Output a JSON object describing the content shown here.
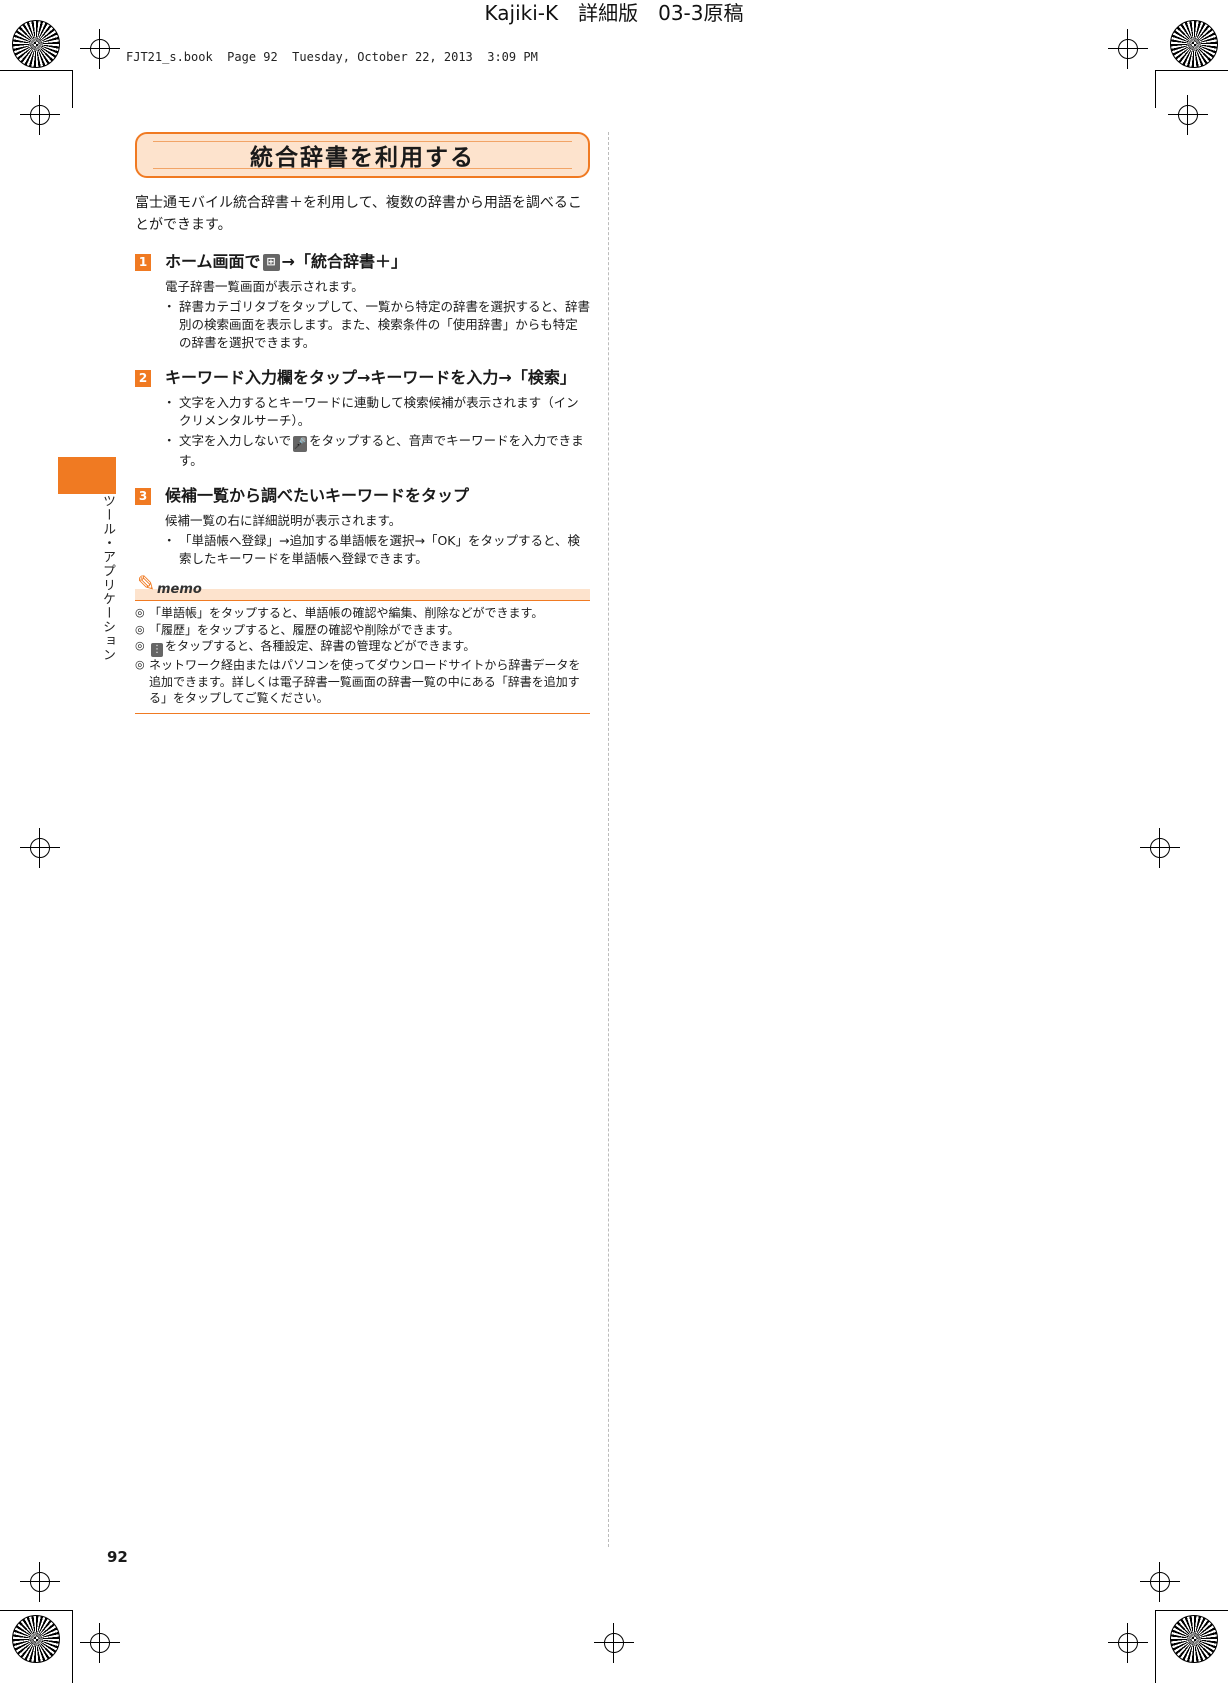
{
  "header": {
    "title": "Kajiki-K　詳細版　03-3原稿",
    "book_info": "FJT21_s.book  Page 92  Tuesday, October 22, 2013  3:09 PM"
  },
  "section": {
    "title": "統合辞書を利用する",
    "intro": "富士通モバイル統合辞書＋を利用して、複数の辞書から用語を調べることができます。"
  },
  "steps": [
    {
      "num": "1",
      "title_before": "ホーム画面で",
      "icon": "grid-icon",
      "title_after": "→「統合辞書＋」",
      "desc": "電子辞書一覧画面が表示されます。",
      "bullets": [
        "辞書カテゴリタブをタップして、一覧から特定の辞書を選択すると、辞書別の検索画面を表示します。また、検索条件の「使用辞書」からも特定の辞書を選択できます。"
      ]
    },
    {
      "num": "2",
      "title": "キーワード入力欄をタップ→キーワードを入力→「検索」",
      "bullets": [
        "文字を入力するとキーワードに連動して検索候補が表示されます（インクリメンタルサーチ）。",
        "文字を入力しないで",
        "をタップすると、音声でキーワードを入力できます。"
      ],
      "mic_icon": "microphone-icon"
    },
    {
      "num": "3",
      "title": "候補一覧から調べたいキーワードをタップ",
      "desc": "候補一覧の右に詳細説明が表示されます。",
      "bullets": [
        "「単語帳へ登録」→追加する単語帳を選択→「OK」をタップすると、検索したキーワードを単語帳へ登録できます。"
      ]
    }
  ],
  "memo": {
    "label": "memo",
    "items": [
      "「単語帳」をタップすると、単語帳の確認や編集、削除などができます。",
      "「履歴」をタップすると、履歴の確認や削除ができます。",
      "をタップすると、各種設定、辞書の管理などができます。",
      "ネットワーク経由またはパソコンを使ってダウンロードサイトから辞書データを追加できます。詳しくは電子辞書一覧画面の辞書一覧の中にある「辞書を追加する」をタップしてご覧ください。"
    ],
    "menu_icon": "menu-icon"
  },
  "side_label": "ツール・アプリケーション",
  "page_number": "92",
  "colors": {
    "accent": "#f07a22",
    "banner_fill": "#fde3cd"
  }
}
